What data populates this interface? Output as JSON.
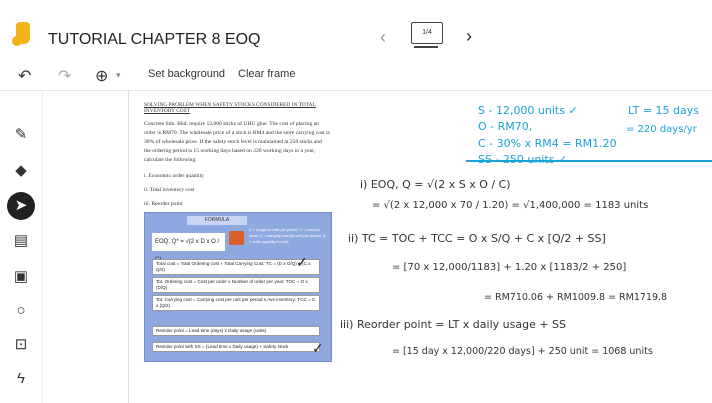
{
  "titlebar": {
    "title": "TUTORIAL CHAPTER 8 EOQ",
    "slide_indicator": "1/4"
  },
  "toolbar": {
    "undo": "↶",
    "redo": "↷",
    "zoom": "⊕",
    "zoom_caret": "▾",
    "set_background": "Set background",
    "clear_frame": "Clear frame"
  },
  "sidebar": {
    "tools": [
      "pen-icon",
      "eraser-icon",
      "select-icon",
      "note-icon",
      "image-icon",
      "shape-icon",
      "textbox-icon",
      "laser-icon"
    ]
  },
  "document": {
    "heading": "SOLVING PROBLEM WHEN SAFETY STOCKS CONSIDERED IN TOTAL INVENTORY COST",
    "paragraph": "Concrete Sdn. Bhd. require 12,000 sticks of UHU glue. The cost of placing an order is RM70. The wholesale price of a stick is RM4 and the store carrying cost is 30% of wholesale price. If the safety stock level is maintained at 250 sticks and the ordering period is 15 working days based on 220 working days in a year, calculate the following:",
    "items": [
      "i. Economic order quantity",
      "ii. Total inventory cost",
      "iii. Reorder point"
    ]
  },
  "formula_card": {
    "title": "FORMULA",
    "eoq": "EOQ, Q* = √(2 x D x O / C)",
    "legend": "D = usage in units per period; O = cost per order; C = carrying cost per unit per period; Q = order quantity in units",
    "rows": [
      "Total cost = Total Ordering cost + Total Carrying Cost; TC = (D x O/Q) + (C x Q/2)",
      "Tot. Ordering cost = Cost per order x Number of order per year; TOC = O x (D/Q)",
      "Tot. Carrying cost = Carrying cost per unit per period x Ave inventory; TCC = C x (Q/2)",
      "Reorder point = Lead time (days) x Daily usage (units)",
      "Reorder point with SS = (Lead time x Daily usage) + Safety stock"
    ]
  },
  "handwriting": {
    "blue_lines": [
      "S - 12,000 units ✓",
      "O - RM70,",
      "C - 30% x RM4 = RM1.20",
      "SS - 250 units ✓",
      "LT = 15 days",
      "= 220 days/yr"
    ],
    "black_lines": [
      "i) EOQ, Q = √(2 x S x O / C)",
      "= √(2 x 12,000 x 70 / 1.20)  = √1,400,000  = 1183 units",
      "ii) TC = TOC + TCC = O x S/Q + C x [Q/2 + SS]",
      "= [70 x 12,000/1183] + 1.20 x [1183/2 + 250]",
      "= RM710.06 + RM1009.8 = RM1719.8",
      "iii) Reorder point = LT x daily usage + SS",
      "= [15 day x 12,000/220 days] + 250 unit = 1068 units"
    ]
  },
  "colors": {
    "accent": "#f3b21a",
    "ink_blue": "#1aa3d6",
    "formula_bg": "#8fa9e0"
  }
}
